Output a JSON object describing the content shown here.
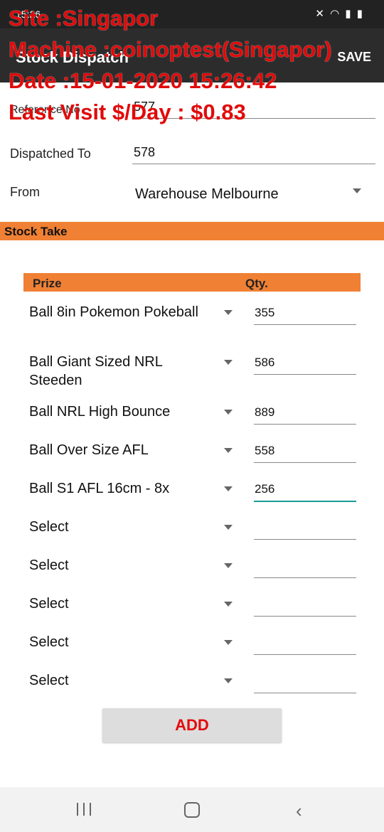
{
  "status_bar": {
    "time": "15:26",
    "icons": "✕ ◠ ▮ ▮"
  },
  "app_bar": {
    "title": "Stock Dispatch",
    "save_label": "SAVE"
  },
  "overlay": {
    "site": "Site :Singapor",
    "machine": "Machine :coinoptest(Singapor)",
    "date": "Date :15-01-2020 15:26:42",
    "last_visit": "Last Visit $/Day : $0.83"
  },
  "form": {
    "reference_label": "Reference No",
    "reference_value": "577",
    "dispatched_to_label": "Dispatched To",
    "dispatched_to_value": "578",
    "from_label": "From",
    "from_value": "Warehouse Melbourne"
  },
  "section_title": "Stock Take",
  "table": {
    "header_prize": "Prize",
    "header_qty": "Qty.",
    "rows": [
      {
        "prize": "Ball 8in Pokemon Pokeball",
        "qty": "355"
      },
      {
        "prize": "Ball Giant Sized NRL Steeden",
        "qty": "586"
      },
      {
        "prize": "Ball NRL High Bounce",
        "qty": "889"
      },
      {
        "prize": "Ball Over Size AFL",
        "qty": "558"
      },
      {
        "prize": "Ball S1 AFL 16cm - 8x",
        "qty": "256"
      },
      {
        "prize": "Select",
        "qty": ""
      },
      {
        "prize": "Select",
        "qty": ""
      },
      {
        "prize": "Select",
        "qty": ""
      },
      {
        "prize": "Select",
        "qty": ""
      },
      {
        "prize": "Select",
        "qty": ""
      }
    ]
  },
  "add_label": "ADD",
  "colors": {
    "accent": "#f08034",
    "overlay_text": "#e10a0a",
    "focus_underline": "#1a9a96"
  }
}
